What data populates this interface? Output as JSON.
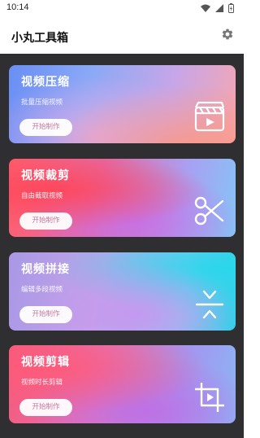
{
  "status_bar": {
    "time": "10:14",
    "icons": [
      "wifi-icon",
      "signal-icon",
      "battery-icon"
    ]
  },
  "app_bar": {
    "title": "小丸工具箱",
    "settings_icon": "gear-icon"
  },
  "cards": [
    {
      "title": "视频压缩",
      "subtitle": "批量压缩视频",
      "button": "开始制作",
      "icon": "video-file-icon"
    },
    {
      "title": "视频裁剪",
      "subtitle": "自由截取视频",
      "button": "开始制作",
      "icon": "scissors-icon"
    },
    {
      "title": "视频拼接",
      "subtitle": "编辑多段视频",
      "button": "开始制作",
      "icon": "merge-icon"
    },
    {
      "title": "视频剪辑",
      "subtitle": "视频时长剪辑",
      "button": "开始制作",
      "icon": "crop-video-icon"
    }
  ],
  "colors": {
    "background_dark": "#2f2f31",
    "button_text": "#c67a9c"
  }
}
